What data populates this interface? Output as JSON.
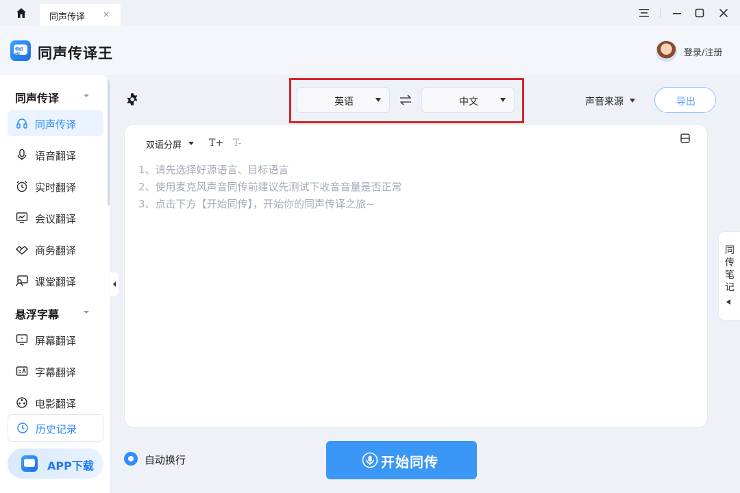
{
  "titlebar": {
    "tab_label": "同声传译",
    "tab_close": "×"
  },
  "header": {
    "app_name": "同声传译王",
    "logo_text": "你好 Hi",
    "login_label": "登录/注册"
  },
  "sidebar": {
    "section1_title": "同声传译",
    "section1_items": [
      {
        "label": "同声传译",
        "icon": "headphones-icon",
        "active": true
      },
      {
        "label": "语音翻译",
        "icon": "microphone-icon"
      },
      {
        "label": "实时翻译",
        "icon": "alarm-clock-icon"
      },
      {
        "label": "会议翻译",
        "icon": "presentation-chart-icon"
      },
      {
        "label": "商务翻译",
        "icon": "handshake-icon"
      },
      {
        "label": "课堂翻译",
        "icon": "classroom-teacher-icon"
      }
    ],
    "section2_title": "悬浮字幕",
    "section2_items": [
      {
        "label": "屏幕翻译",
        "icon": "monitor-icon"
      },
      {
        "label": "字幕翻译",
        "icon": "subtitle-icon"
      },
      {
        "label": "电影翻译",
        "icon": "film-reel-icon"
      }
    ],
    "history_label": "历史记录",
    "app_download_label": "APP下载"
  },
  "toolbar": {
    "source_lang": "英语",
    "target_lang": "中文",
    "audio_source_label": "声音来源",
    "export_label": "导出",
    "highlight_color": "#d9232a"
  },
  "panel": {
    "split_mode_label": "双语分屏",
    "font_increase": "T+",
    "font_decrease": "T-",
    "tips": [
      "1、请先选择好源语言、目标语言",
      "2、使用麦克风声音同传前建议先测试下收音音量是否正常",
      "3、点击下方【开始同传】，开始你的同声传译之旅~"
    ]
  },
  "notes_tab": {
    "label": "同传笔记"
  },
  "bottom": {
    "auto_wrap_label": "自动换行",
    "auto_wrap_checked": true,
    "start_label": "开始同传"
  },
  "colors": {
    "accent": "#2f8cff",
    "start_button": "#3b97f5",
    "tip_text": "#a3adba"
  }
}
